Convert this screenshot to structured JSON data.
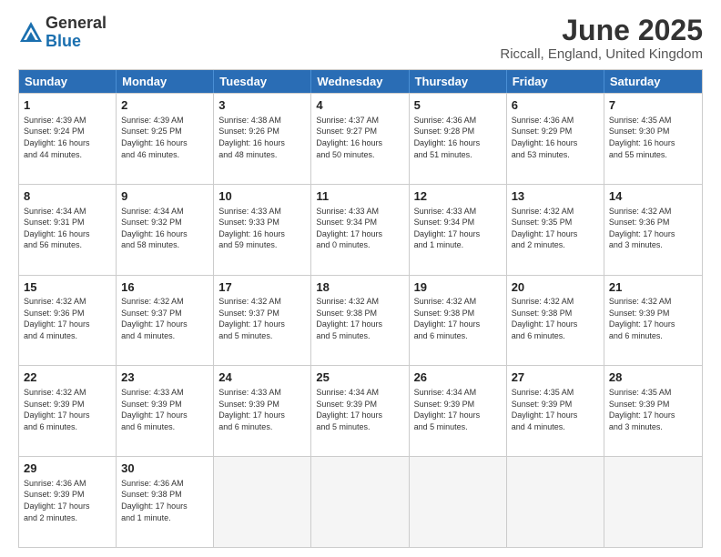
{
  "header": {
    "logo_general": "General",
    "logo_blue": "Blue",
    "title": "June 2025",
    "location": "Riccall, England, United Kingdom"
  },
  "days_of_week": [
    "Sunday",
    "Monday",
    "Tuesday",
    "Wednesday",
    "Thursday",
    "Friday",
    "Saturday"
  ],
  "weeks": [
    [
      {
        "day": "1",
        "info": "Sunrise: 4:39 AM\nSunset: 9:24 PM\nDaylight: 16 hours\nand 44 minutes."
      },
      {
        "day": "2",
        "info": "Sunrise: 4:39 AM\nSunset: 9:25 PM\nDaylight: 16 hours\nand 46 minutes."
      },
      {
        "day": "3",
        "info": "Sunrise: 4:38 AM\nSunset: 9:26 PM\nDaylight: 16 hours\nand 48 minutes."
      },
      {
        "day": "4",
        "info": "Sunrise: 4:37 AM\nSunset: 9:27 PM\nDaylight: 16 hours\nand 50 minutes."
      },
      {
        "day": "5",
        "info": "Sunrise: 4:36 AM\nSunset: 9:28 PM\nDaylight: 16 hours\nand 51 minutes."
      },
      {
        "day": "6",
        "info": "Sunrise: 4:36 AM\nSunset: 9:29 PM\nDaylight: 16 hours\nand 53 minutes."
      },
      {
        "day": "7",
        "info": "Sunrise: 4:35 AM\nSunset: 9:30 PM\nDaylight: 16 hours\nand 55 minutes."
      }
    ],
    [
      {
        "day": "8",
        "info": "Sunrise: 4:34 AM\nSunset: 9:31 PM\nDaylight: 16 hours\nand 56 minutes."
      },
      {
        "day": "9",
        "info": "Sunrise: 4:34 AM\nSunset: 9:32 PM\nDaylight: 16 hours\nand 58 minutes."
      },
      {
        "day": "10",
        "info": "Sunrise: 4:33 AM\nSunset: 9:33 PM\nDaylight: 16 hours\nand 59 minutes."
      },
      {
        "day": "11",
        "info": "Sunrise: 4:33 AM\nSunset: 9:34 PM\nDaylight: 17 hours\nand 0 minutes."
      },
      {
        "day": "12",
        "info": "Sunrise: 4:33 AM\nSunset: 9:34 PM\nDaylight: 17 hours\nand 1 minute."
      },
      {
        "day": "13",
        "info": "Sunrise: 4:32 AM\nSunset: 9:35 PM\nDaylight: 17 hours\nand 2 minutes."
      },
      {
        "day": "14",
        "info": "Sunrise: 4:32 AM\nSunset: 9:36 PM\nDaylight: 17 hours\nand 3 minutes."
      }
    ],
    [
      {
        "day": "15",
        "info": "Sunrise: 4:32 AM\nSunset: 9:36 PM\nDaylight: 17 hours\nand 4 minutes."
      },
      {
        "day": "16",
        "info": "Sunrise: 4:32 AM\nSunset: 9:37 PM\nDaylight: 17 hours\nand 4 minutes."
      },
      {
        "day": "17",
        "info": "Sunrise: 4:32 AM\nSunset: 9:37 PM\nDaylight: 17 hours\nand 5 minutes."
      },
      {
        "day": "18",
        "info": "Sunrise: 4:32 AM\nSunset: 9:38 PM\nDaylight: 17 hours\nand 5 minutes."
      },
      {
        "day": "19",
        "info": "Sunrise: 4:32 AM\nSunset: 9:38 PM\nDaylight: 17 hours\nand 6 minutes."
      },
      {
        "day": "20",
        "info": "Sunrise: 4:32 AM\nSunset: 9:38 PM\nDaylight: 17 hours\nand 6 minutes."
      },
      {
        "day": "21",
        "info": "Sunrise: 4:32 AM\nSunset: 9:39 PM\nDaylight: 17 hours\nand 6 minutes."
      }
    ],
    [
      {
        "day": "22",
        "info": "Sunrise: 4:32 AM\nSunset: 9:39 PM\nDaylight: 17 hours\nand 6 minutes."
      },
      {
        "day": "23",
        "info": "Sunrise: 4:33 AM\nSunset: 9:39 PM\nDaylight: 17 hours\nand 6 minutes."
      },
      {
        "day": "24",
        "info": "Sunrise: 4:33 AM\nSunset: 9:39 PM\nDaylight: 17 hours\nand 6 minutes."
      },
      {
        "day": "25",
        "info": "Sunrise: 4:34 AM\nSunset: 9:39 PM\nDaylight: 17 hours\nand 5 minutes."
      },
      {
        "day": "26",
        "info": "Sunrise: 4:34 AM\nSunset: 9:39 PM\nDaylight: 17 hours\nand 5 minutes."
      },
      {
        "day": "27",
        "info": "Sunrise: 4:35 AM\nSunset: 9:39 PM\nDaylight: 17 hours\nand 4 minutes."
      },
      {
        "day": "28",
        "info": "Sunrise: 4:35 AM\nSunset: 9:39 PM\nDaylight: 17 hours\nand 3 minutes."
      }
    ],
    [
      {
        "day": "29",
        "info": "Sunrise: 4:36 AM\nSunset: 9:39 PM\nDaylight: 17 hours\nand 2 minutes."
      },
      {
        "day": "30",
        "info": "Sunrise: 4:36 AM\nSunset: 9:38 PM\nDaylight: 17 hours\nand 1 minute."
      },
      {
        "day": "",
        "info": ""
      },
      {
        "day": "",
        "info": ""
      },
      {
        "day": "",
        "info": ""
      },
      {
        "day": "",
        "info": ""
      },
      {
        "day": "",
        "info": ""
      }
    ]
  ]
}
